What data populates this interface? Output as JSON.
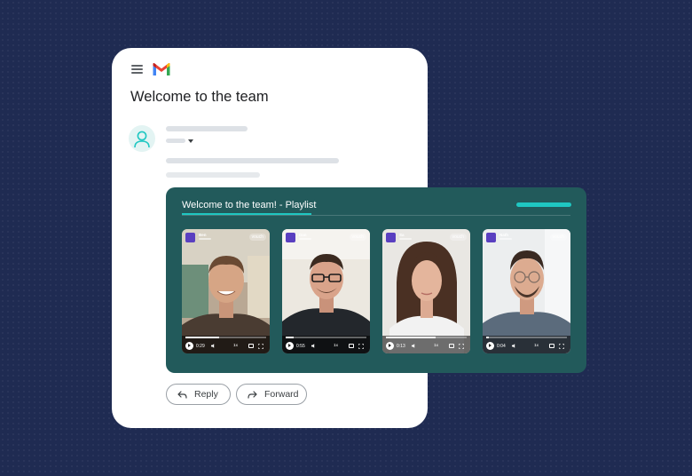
{
  "email": {
    "subject": "Welcome to the team",
    "actions": {
      "reply_label": "Reply",
      "forward_label": "Forward"
    }
  },
  "playlist": {
    "title": "Welcome to the team! - Playlist",
    "accent_color": "#1fc7c2",
    "panel_color": "#225a5b",
    "videos": [
      {
        "name": "Ben",
        "brand": "vouch",
        "time": "0:29",
        "speed": "1x",
        "progress": 0.42
      },
      {
        "name": "Dan",
        "brand": "vouch",
        "time": "0:55",
        "speed": "1x",
        "progress": 0.1
      },
      {
        "name": "Sa",
        "brand": "vouch",
        "time": "0:13",
        "speed": "1x",
        "progress": 0.62
      },
      {
        "name": "Nath",
        "brand": "vouch",
        "time": "0:04",
        "speed": "1x",
        "progress": 0.03
      }
    ]
  },
  "icons": {
    "menu": "hamburger-menu-icon",
    "logo": "gmail-logo-icon",
    "avatar": "user-avatar-icon",
    "reply": "reply-arrow-icon",
    "forward": "forward-arrow-icon",
    "play": "play-icon",
    "volume": "volume-icon",
    "captions": "captions-icon",
    "fullscreen": "fullscreen-icon"
  },
  "colors": {
    "background": "#1f2b52",
    "gmail_red": "#ea4335",
    "gmail_blue": "#4285f4",
    "gmail_green": "#34a853",
    "gmail_yellow": "#fbbc04"
  }
}
